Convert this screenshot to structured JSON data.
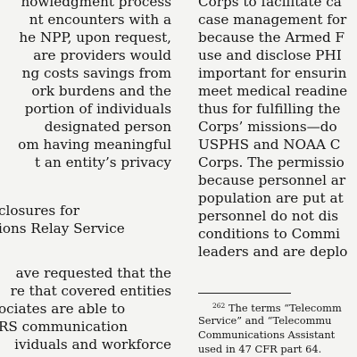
{
  "left_column": {
    "lines": [
      "nowledgment process",
      "nt encounters with a",
      "he NPP, upon request,",
      "are providers would",
      "ng costs savings from",
      "ork burdens and the",
      "portion of individuals",
      "designated person",
      "om having meaningful",
      "t an entity’s privacy",
      "closures for",
      "ions Relay Service",
      "ave requested that the",
      "re that covered entities",
      "ociates are able to",
      "RS communication",
      "ividuals and workforce"
    ]
  },
  "right_column": {
    "lines": [
      "Corps to facilitate ca",
      "case management for",
      "because the Armed F",
      "use and disclose PHI",
      "important for ensurin",
      "meet medical readine",
      "thus for fulfilling the",
      "Corps’ missions—do",
      "USPHS and NOAA C",
      "Corps. The permissio",
      "because personnel ar",
      "population are put at",
      "personnel do not dis",
      "conditions to Commi",
      "leaders and are deplo"
    ]
  },
  "footnote": {
    "number": "262",
    "lines": [
      " The terms “Telecomm",
      "Service” and “Telecommu",
      "Communications Assistant",
      "used in 47 CFR part 64."
    ]
  }
}
